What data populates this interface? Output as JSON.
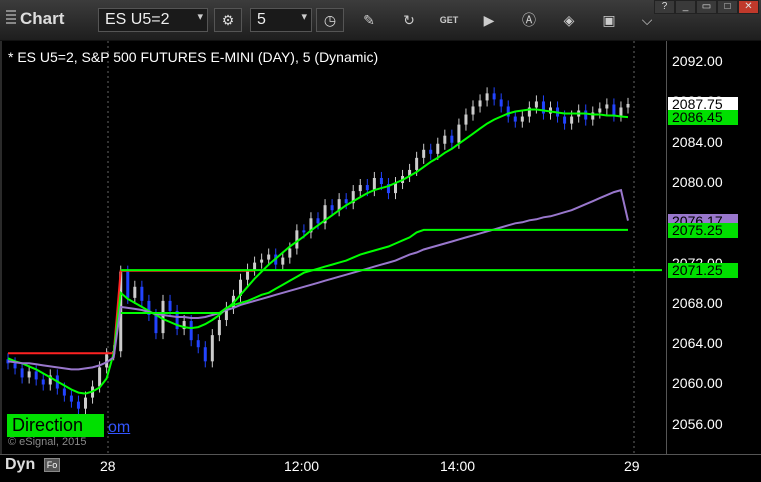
{
  "window": {
    "title": "Chart"
  },
  "toolbar": {
    "symbol_value": "ES U5=2",
    "interval_value": "5",
    "tools": [
      "settings-icon",
      "clock-icon",
      "pencil-icon",
      "refresh-icon",
      "get-icon",
      "play-icon",
      "alert-icon",
      "tag-icon",
      "camera-icon",
      "more-icon"
    ]
  },
  "chart_title": "* ES U5=2, S&P 500 FUTURES E-MINI (DAY), 5 (Dynamic)",
  "price_tags": [
    {
      "text": "2087.75",
      "bg": "#ffffff",
      "fg": "#000000"
    },
    {
      "text": "2086.45",
      "bg": "#00e000",
      "fg": "#000000"
    },
    {
      "text": "2076.17",
      "bg": "#9977cc",
      "fg": "#000000"
    },
    {
      "text": "2075.25",
      "bg": "#00e000",
      "fg": "#000000"
    },
    {
      "text": "2071.25",
      "bg": "#00e000",
      "fg": "#000000"
    }
  ],
  "overlay": {
    "direction_label": "Direction",
    "link_text": "om",
    "copyright": "© eSignal, 2015"
  },
  "bottom": {
    "dyn_label": "Dyn",
    "dyn_icon": "Fo"
  },
  "colors": {
    "up": "#cccccc",
    "down": "#2244ff",
    "red_line": "#ff2222",
    "green_line": "#00ff00",
    "purple_line": "#9977cc"
  },
  "chart_data": {
    "type": "candlestick",
    "ylim": [
      2053,
      2094
    ],
    "yticks": [
      "2092.00",
      "2088.00",
      "2084.00",
      "2080.00",
      "2076.00",
      "2072.00",
      "2068.00",
      "2064.00",
      "2060.00",
      "2056.00"
    ],
    "xticks": [
      "28",
      "12:00",
      "14:00",
      "29"
    ],
    "closes": [
      2062.0,
      2061.5,
      2060.6,
      2061.2,
      2060.4,
      2059.9,
      2060.8,
      2059.5,
      2058.8,
      2058.2,
      2057.5,
      2058.6,
      2059.7,
      2061.6,
      2062.9,
      2063.2,
      2071.1,
      2068.5,
      2069.6,
      2068.2,
      2066.8,
      2065.0,
      2068.2,
      2067.2,
      2065.4,
      2066.2,
      2064.3,
      2063.6,
      2062.2,
      2064.8,
      2066.3,
      2067.5,
      2068.7,
      2070.3,
      2071.3,
      2072.0,
      2072.3,
      2072.8,
      2071.8,
      2072.5,
      2073.4,
      2075.2,
      2075.0,
      2076.4,
      2075.9,
      2077.7,
      2077.2,
      2078.3,
      2077.9,
      2079.1,
      2079.7,
      2079.2,
      2080.4,
      2079.8,
      2078.9,
      2079.9,
      2080.6,
      2081.2,
      2082.4,
      2083.2,
      2082.8,
      2083.8,
      2084.6,
      2083.9,
      2085.7,
      2086.7,
      2087.5,
      2088.1,
      2088.8,
      2088.2,
      2087.5,
      2086.5,
      2086.0,
      2086.5,
      2087.4,
      2088.0,
      2086.8,
      2087.4,
      2086.5,
      2085.8,
      2086.5,
      2087.1,
      2086.2,
      2086.9,
      2087.3,
      2087.7,
      2086.6,
      2087.4,
      2087.75
    ],
    "series": [
      {
        "name": "",
        "color": "#ff2222",
        "segments": [
          [
            2063,
            2063,
            2063,
            2063,
            2063,
            2063,
            2063,
            2063,
            2063,
            2063,
            2063,
            2063,
            2063,
            2063,
            2063,
            2063,
            2071.2,
            2071.2,
            2071.2,
            2071.2,
            2071.2,
            2071.2,
            2071.2,
            2071.2,
            2071.2,
            2071.2,
            2071.2,
            2071.2,
            2071.2,
            2071.2,
            2071.2,
            2071.2,
            2071.2,
            2071.2,
            2071.2,
            2071.2
          ]
        ]
      },
      {
        "name": "",
        "color": "#00ff00",
        "values": [
          2062.5,
          2062.2,
          2062.0,
          2061.7,
          2061.4,
          2061.0,
          2060.6,
          2060.2,
          2059.8,
          2059.4,
          2059.1,
          2059.0,
          2059.2,
          2059.6,
          2060.5,
          2063.0,
          2069.0,
          2068.4,
          2068.0,
          2067.6,
          2067.2,
          2066.8,
          2066.4,
          2066.1,
          2065.8,
          2065.6,
          2065.5,
          2065.6,
          2065.9,
          2066.3,
          2066.8,
          2067.4,
          2068.0,
          2068.8,
          2069.6,
          2070.4,
          2071.1,
          2071.8,
          2072.4,
          2073.0,
          2073.6,
          2074.1,
          2074.6,
          2075.2,
          2075.7,
          2076.2,
          2076.7,
          2077.2,
          2077.7,
          2078.1,
          2078.5,
          2078.9,
          2079.2,
          2079.4,
          2079.6,
          2079.9,
          2080.2,
          2080.6,
          2081.0,
          2081.5,
          2082.0,
          2082.4,
          2082.9,
          2083.3,
          2083.8,
          2084.3,
          2084.8,
          2085.3,
          2085.8,
          2086.2,
          2086.5,
          2086.8,
          2087.0,
          2087.1,
          2087.2,
          2087.2,
          2087.1,
          2087.0,
          2086.9,
          2086.8,
          2086.8,
          2086.8,
          2086.8,
          2086.7,
          2086.7,
          2086.6,
          2086.6,
          2086.5,
          2086.45
        ]
      },
      {
        "name": "",
        "color": "#9977cc",
        "values": [
          2062.2,
          2062.1,
          2062.0,
          2062.0,
          2061.9,
          2061.8,
          2061.7,
          2061.6,
          2061.5,
          2061.4,
          2061.4,
          2061.5,
          2061.6,
          2061.8,
          2062.1,
          2062.6,
          2067.6,
          2067.5,
          2067.4,
          2067.3,
          2067.1,
          2066.9,
          2066.8,
          2066.7,
          2066.6,
          2066.6,
          2066.5,
          2066.5,
          2066.6,
          2066.8,
          2067.0,
          2067.3,
          2067.5,
          2067.8,
          2068.0,
          2068.2,
          2068.4,
          2068.6,
          2068.8,
          2069.0,
          2069.2,
          2069.4,
          2069.6,
          2069.8,
          2070.0,
          2070.2,
          2070.4,
          2070.6,
          2070.8,
          2071.0,
          2071.2,
          2071.4,
          2071.6,
          2071.8,
          2072.0,
          2072.2,
          2072.5,
          2072.8,
          2073.0,
          2073.3,
          2073.5,
          2073.7,
          2073.9,
          2074.1,
          2074.3,
          2074.5,
          2074.7,
          2074.9,
          2075.1,
          2075.3,
          2075.5,
          2075.7,
          2075.9,
          2076.0,
          2076.2,
          2076.3,
          2076.5,
          2076.6,
          2076.8,
          2077.0,
          2077.2,
          2077.5,
          2077.8,
          2078.1,
          2078.4,
          2078.7,
          2079.0,
          2079.2,
          2076.17
        ]
      },
      {
        "name": "",
        "color": "#00ff00",
        "values": [
          null,
          null,
          null,
          null,
          null,
          null,
          null,
          null,
          null,
          null,
          null,
          null,
          null,
          null,
          null,
          null,
          2067.0,
          2067.0,
          2067.0,
          2067.0,
          2067.0,
          2067.0,
          2067.0,
          2067.0,
          2067.0,
          2067.0,
          2067.0,
          2067.0,
          2067.0,
          2067.0,
          2067.0,
          2067.5,
          2067.8,
          2068.0,
          2068.2,
          2068.5,
          2068.8,
          2069.0,
          2069.4,
          2069.8,
          2070.2,
          2070.6,
          2071.0,
          2071.2,
          2071.4,
          2071.6,
          2071.8,
          2072.0,
          2072.2,
          2072.5,
          2072.8,
          2073.0,
          2073.2,
          2073.4,
          2073.6,
          2073.9,
          2074.2,
          2074.5,
          2075.0,
          2075.25,
          2075.25,
          2075.25,
          2075.25,
          2075.25,
          2075.25,
          2075.25,
          2075.25,
          2075.25,
          2075.25,
          2075.25,
          2075.25,
          2075.25,
          2075.25,
          2075.25,
          2075.25,
          2075.25,
          2075.25,
          2075.25,
          2075.25,
          2075.25,
          2075.25,
          2075.25,
          2075.25,
          2075.25,
          2075.25,
          2075.25,
          2075.25,
          2075.25,
          2075.25
        ]
      },
      {
        "name": "",
        "color": "#00ff00",
        "level": 2071.25
      }
    ]
  }
}
